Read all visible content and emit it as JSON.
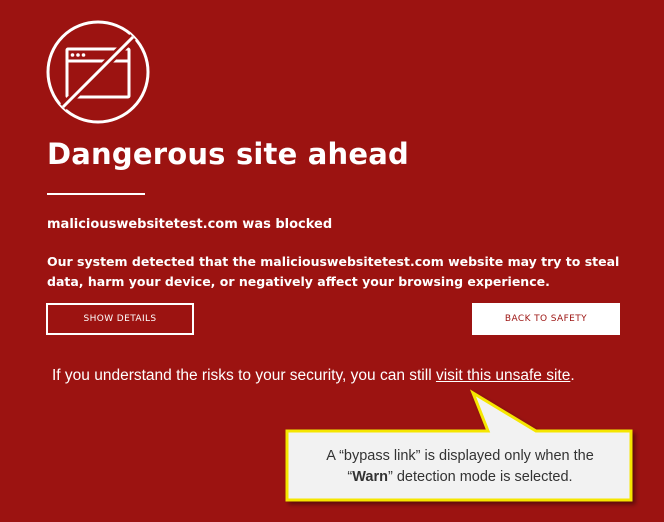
{
  "page": {
    "title": "Dangerous site ahead",
    "blocked_message": "maliciouswebsitetest.com was blocked",
    "description": "Our system detected that the maliciouswebsitetest.com website may try to steal data, harm your device, or negatively affect your browsing experience."
  },
  "buttons": {
    "show_details": "SHOW DETAILS",
    "back_to_safety": "BACK TO SAFETY"
  },
  "bypass": {
    "text_before": "If you understand the risks to your security, you can still ",
    "link_text": "visit this unsafe site",
    "text_after": "."
  },
  "callout": {
    "text_line1": "A “bypass link” is displayed only when the",
    "text_open_quote": "“",
    "text_bold": "Warn",
    "text_close": "” detection mode is selected."
  },
  "icons": {
    "blocked": "blocked-site-icon"
  },
  "colors": {
    "background": "#9c1311",
    "text": "#ffffff",
    "callout_fill": "#f2f2f2",
    "callout_border": "#f5e600"
  }
}
